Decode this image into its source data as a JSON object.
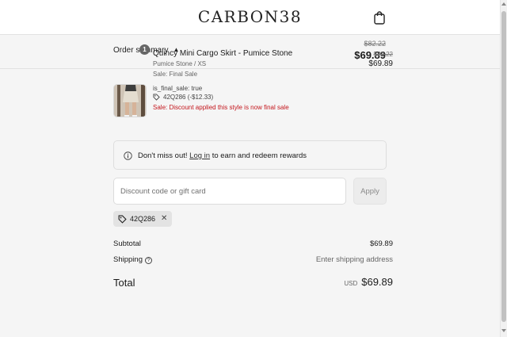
{
  "header": {
    "logo": "CARBON38",
    "cart_icon": "shopping-bag-icon"
  },
  "summary": {
    "toggle_label": "Order summary",
    "toggle_icon": "chevron-up-icon",
    "compare_price": "$82.22",
    "total": "$69.89"
  },
  "line_item": {
    "quantity": "1",
    "title": "Quincy Mini Cargo Skirt - Pumice Stone",
    "variant": "Pumice Stone / XS",
    "sale_note": "Sale: Final Sale",
    "property": "is_final_sale: true",
    "discount_code": "42Q286 (-$12.33)",
    "discount_icon": "tag-icon",
    "final_sale_note": "Sale: Discount applied this style is now final sale",
    "compare_price": "$82.22",
    "price": "$69.89",
    "thumbnail_icon": "product-thumbnail"
  },
  "rewards": {
    "icon": "info-icon",
    "prefix": "Don't miss out!",
    "link": "Log in",
    "suffix": "to earn and redeem rewards"
  },
  "discount": {
    "placeholder": "Discount code or gift card",
    "apply_label": "Apply",
    "applied_code": "42Q286",
    "remove_icon": "close-icon"
  },
  "totals": {
    "subtotal_label": "Subtotal",
    "subtotal_value": "$69.89",
    "shipping_label": "Shipping",
    "shipping_help": "?",
    "shipping_value": "Enter shipping address",
    "total_label": "Total",
    "currency": "USD",
    "total_value": "$69.89"
  },
  "colors": {
    "accent_red": "#c4161c",
    "background": "#f5f5f5"
  }
}
